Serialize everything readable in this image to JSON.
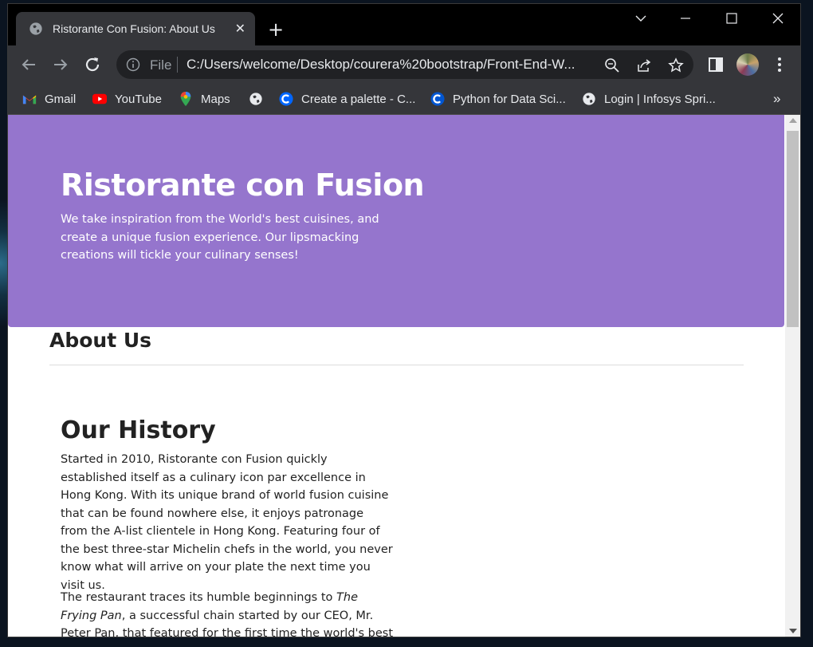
{
  "browser": {
    "tab_title": "Ristorante Con Fusion: About Us",
    "tab_close": "✕",
    "new_tab": "+",
    "omnibox": {
      "scheme_label": "File",
      "url": "C:/Users/welcome/Desktop/courera%20bootstrap/Front-End-W..."
    }
  },
  "bookmarks": [
    {
      "label": "Gmail",
      "icon": "gmail-icon"
    },
    {
      "label": "YouTube",
      "icon": "youtube-icon"
    },
    {
      "label": "Maps",
      "icon": "maps-icon"
    },
    {
      "label": "",
      "icon": "globe-icon"
    },
    {
      "label": "Create a palette - C...",
      "icon": "coolors-icon"
    },
    {
      "label": "Python for Data Sci...",
      "icon": "coursera-icon"
    },
    {
      "label": "Login | Infosys Spri...",
      "icon": "globe-icon"
    }
  ],
  "bookmarks_overflow": "»",
  "page": {
    "jumbotron": {
      "title": "Ristorante con Fusion",
      "text": "We take inspiration from the World's best cuisines, and create a unique fusion experience. Our lipsmacking creations will tickle your culinary senses!"
    },
    "about_heading": "About Us",
    "history_heading": "Our History",
    "history_para_1": "Started in 2010, Ristorante con Fusion quickly established itself as a culinary icon par excellence in Hong Kong. With its unique brand of world fusion cuisine that can be found nowhere else, it enjoys patronage from the A-list clientele in Hong Kong. Featuring four of the best three-star Michelin chefs in the world, you never know what will arrive on your plate the next time you visit us.",
    "history_para_2_pre": "The restaurant traces its humble beginnings to ",
    "history_para_2_em": "The Frying Pan",
    "history_para_2_post": ", a successful chain started by our CEO, Mr. Peter Pan, that featured for the first time the world's best cuisines in a pan."
  },
  "colors": {
    "jumbotron_bg": "#9575cd",
    "chrome_dark": "#35363a"
  }
}
